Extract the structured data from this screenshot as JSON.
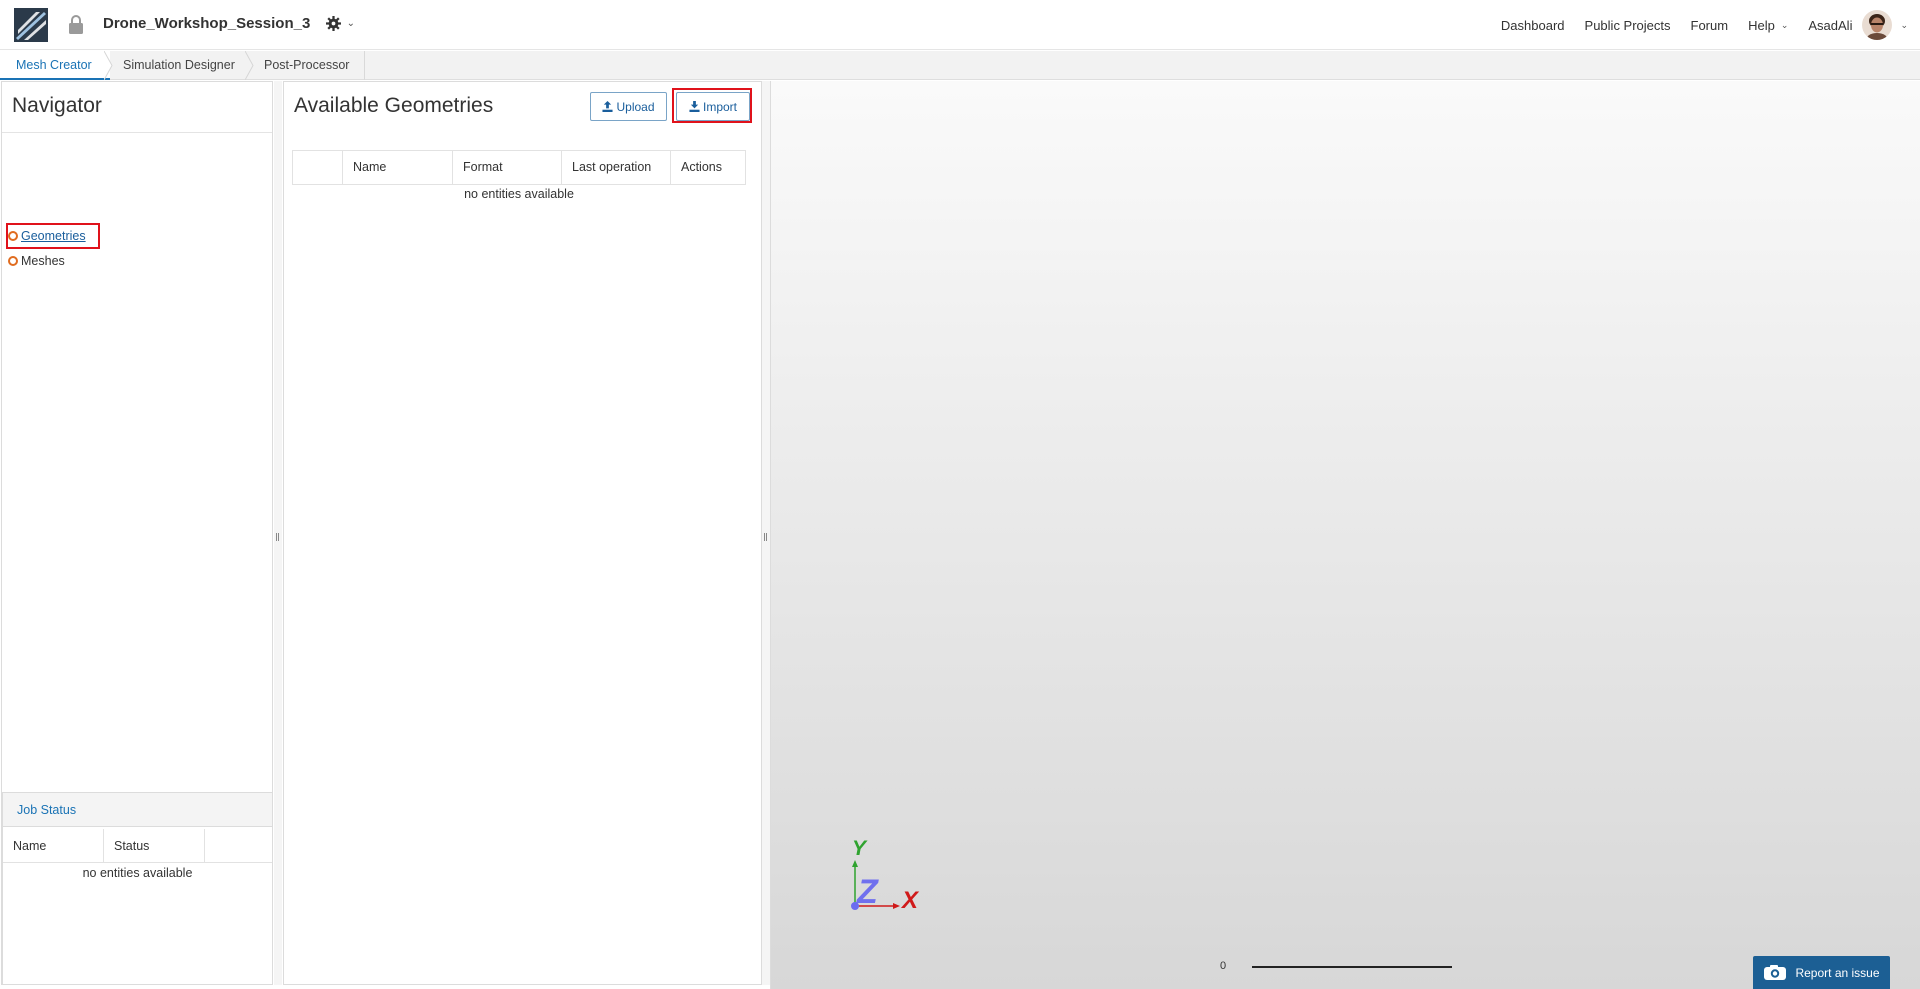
{
  "header": {
    "project_title": "Drone_Workshop_Session_3",
    "nav": {
      "dashboard": "Dashboard",
      "public_projects": "Public Projects",
      "forum": "Forum",
      "help": "Help",
      "user": "AsadAli"
    }
  },
  "tabs": [
    "Mesh Creator",
    "Simulation Designer",
    "Post-Processor"
  ],
  "navigator": {
    "title": "Navigator",
    "items": [
      {
        "label": "Geometries",
        "icon": "circle-outline-icon"
      },
      {
        "label": "Meshes",
        "icon": "circle-outline-icon"
      }
    ]
  },
  "job_status": {
    "title": "Job Status",
    "columns": [
      "Name",
      "Status",
      ""
    ],
    "empty_text": "no entities available"
  },
  "geometries_panel": {
    "title": "Available Geometries",
    "upload_label": "Upload",
    "import_label": "Import",
    "columns": [
      "",
      "Name",
      "Format",
      "Last operation",
      "Actions"
    ],
    "empty_text": "no entities available"
  },
  "viewport": {
    "axis_x": "X",
    "axis_y": "Y",
    "axis_z": "Z",
    "scale_label": "0",
    "report_label": "Report an issue"
  },
  "colors": {
    "accent": "#1a73b5",
    "highlight": "#e0121b",
    "tree_circle": "#e06c1f",
    "report_button": "#1c5f94"
  }
}
